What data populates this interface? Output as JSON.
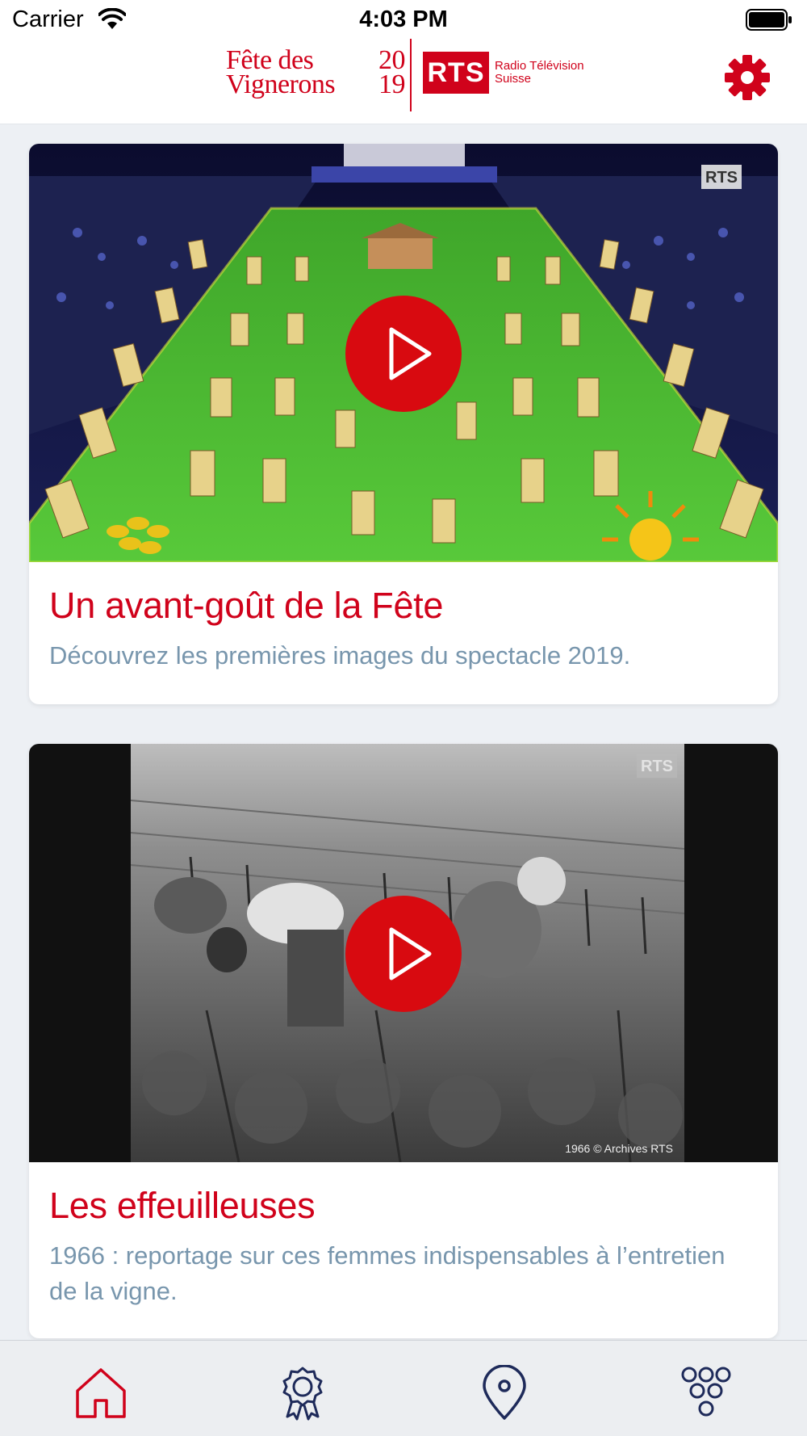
{
  "status_bar": {
    "carrier": "Carrier",
    "time": "4:03 PM"
  },
  "header": {
    "logo_line1_word": "Fête des",
    "logo_line1_num": "20",
    "logo_line2_word": "Vignerons",
    "logo_line2_num": "19",
    "rts_logo": "RTS",
    "rts_line1": "Radio Télévision",
    "rts_line2": "Suisse",
    "settings_icon": "gear-icon"
  },
  "cards": [
    {
      "title": "Un avant-goût de la Fête",
      "description": "Découvrez les premières images du spectacle 2019.",
      "watermark": "RTS",
      "play_icon": "play-icon"
    },
    {
      "title": "Les effeuilleuses",
      "description": "1966 : reportage sur ces femmes indispensables à l’entretien de la vigne.",
      "watermark": "RTS",
      "caption": "1966 © Archives RTS",
      "play_icon": "play-icon"
    }
  ],
  "tab_bar": {
    "tabs": [
      {
        "icon": "home-icon",
        "active": true
      },
      {
        "icon": "award-ribbon-icon",
        "active": false
      },
      {
        "icon": "map-pin-icon",
        "active": false
      },
      {
        "icon": "grapes-icon",
        "active": false
      }
    ],
    "active_color": "#d0021b",
    "inactive_color": "#1e2a5a"
  },
  "colors": {
    "accent": "#d0021b",
    "description_text": "#7896ad",
    "background": "#edf0f4"
  }
}
